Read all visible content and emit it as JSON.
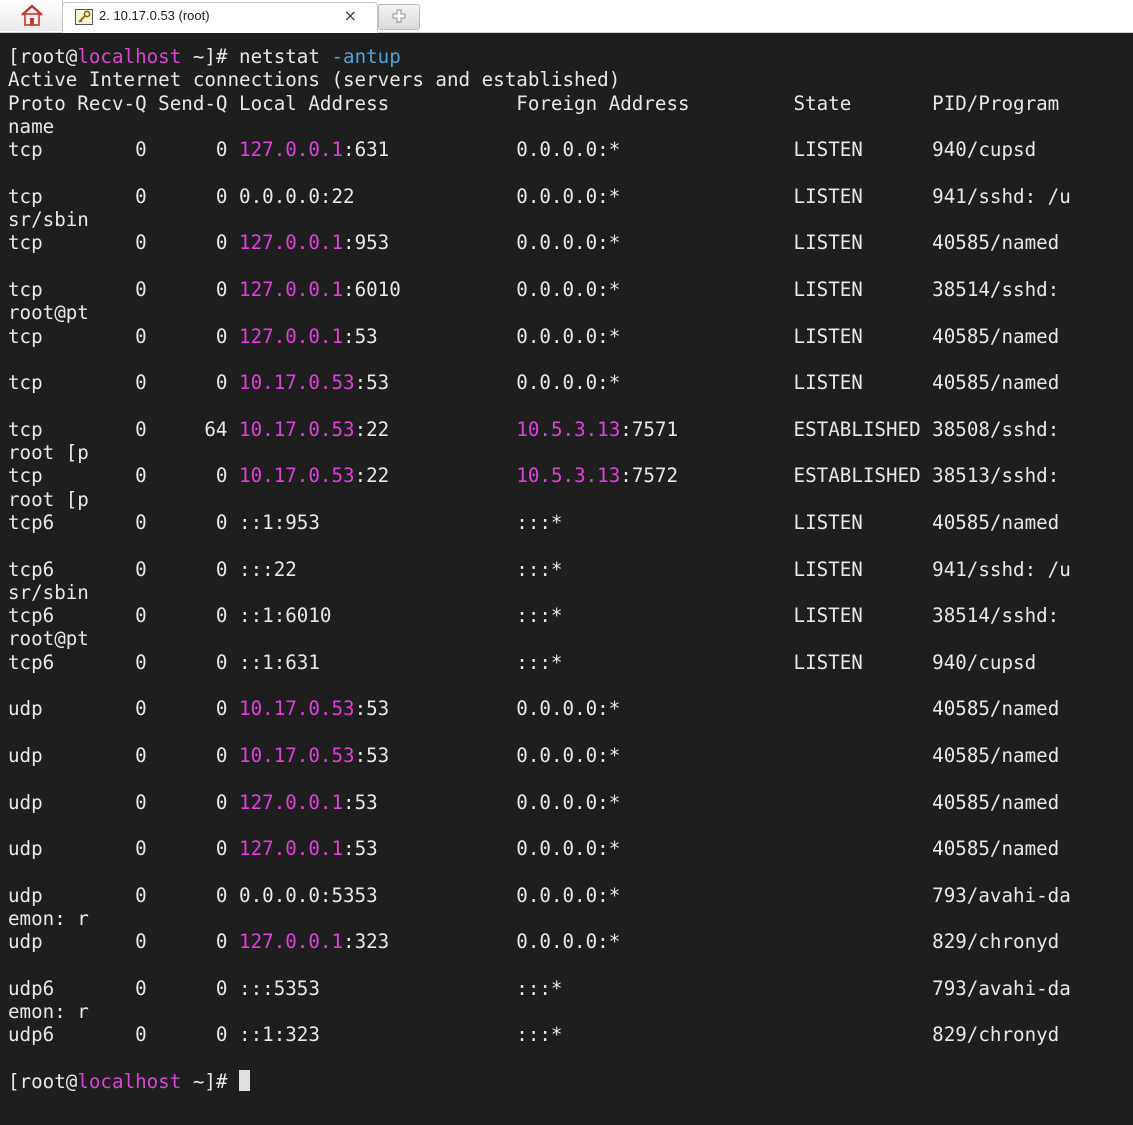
{
  "tab": {
    "title": "2. 10.17.0.53 (root)",
    "close_glyph": "×"
  },
  "icons": {
    "home": "home-icon",
    "session": "key-icon",
    "new_tab": "new-tab-icon"
  },
  "colors": {
    "background": "#1e1e1e",
    "text": "#e8e8e8",
    "ip_highlight": "#e040dc",
    "option": "#4fa3d8"
  },
  "prompt": {
    "open": "[root@",
    "host": "localhost",
    "close": " ~]# "
  },
  "command": {
    "name": "netstat ",
    "option": "-antup"
  },
  "terminal": {
    "lines": [
      "Active Internet connections (servers and established)",
      "Proto Recv-Q Send-Q Local Address           Foreign Address         State       PID/Program",
      "name",
      "tcp        0      0 127.0.0.1:631           0.0.0.0:*               LISTEN      940/cupsd",
      "",
      "tcp        0      0 0.0.0.0:22              0.0.0.0:*               LISTEN      941/sshd: /u",
      "sr/sbin",
      "tcp        0      0 127.0.0.1:953           0.0.0.0:*               LISTEN      40585/named",
      "",
      "tcp        0      0 127.0.0.1:6010          0.0.0.0:*               LISTEN      38514/sshd:",
      "root@pt",
      "tcp        0      0 127.0.0.1:53            0.0.0.0:*               LISTEN      40585/named",
      "",
      "tcp        0      0 10.17.0.53:53           0.0.0.0:*               LISTEN      40585/named",
      "",
      "tcp        0     64 10.17.0.53:22           10.5.3.13:7571          ESTABLISHED 38508/sshd:",
      "root [p",
      "tcp        0      0 10.17.0.53:22           10.5.3.13:7572          ESTABLISHED 38513/sshd:",
      "root [p",
      "tcp6       0      0 ::1:953                 :::*                    LISTEN      40585/named",
      "",
      "tcp6       0      0 :::22                   :::*                    LISTEN      941/sshd: /u",
      "sr/sbin",
      "tcp6       0      0 ::1:6010                :::*                    LISTEN      38514/sshd:",
      "root@pt",
      "tcp6       0      0 ::1:631                 :::*                    LISTEN      940/cupsd",
      "",
      "udp        0      0 10.17.0.53:53           0.0.0.0:*                           40585/named",
      "",
      "udp        0      0 10.17.0.53:53           0.0.0.0:*                           40585/named",
      "",
      "udp        0      0 127.0.0.1:53            0.0.0.0:*                           40585/named",
      "",
      "udp        0      0 127.0.0.1:53            0.0.0.0:*                           40585/named",
      "",
      "udp        0      0 0.0.0.0:5353            0.0.0.0:*                           793/avahi-da",
      "emon: r",
      "udp        0      0 127.0.0.1:323           0.0.0.0:*                           829/chronyd",
      "",
      "udp6       0      0 :::5353                 :::*                                793/avahi-da",
      "emon: r",
      "udp6       0      0 ::1:323                 :::*                                829/chronyd",
      ""
    ]
  }
}
